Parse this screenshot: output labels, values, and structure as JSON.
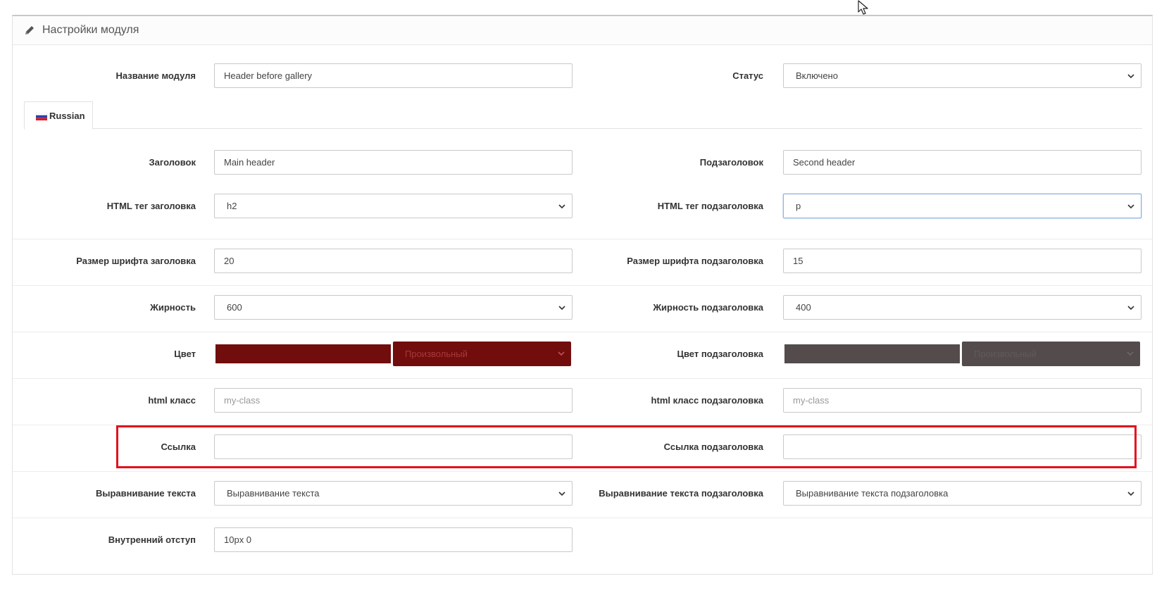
{
  "panel": {
    "title": "Настройки модуля"
  },
  "module_name": {
    "label": "Название модуля",
    "value": "Header before gallery"
  },
  "status": {
    "label": "Статус",
    "value": "Включено"
  },
  "language_tab": {
    "label": "Russian"
  },
  "heading": {
    "label": "Заголовок",
    "value": "Main header"
  },
  "subheading": {
    "label": "Подзаголовок",
    "value": "Second header"
  },
  "heading_tag": {
    "label": "HTML тег заголовка",
    "value": "h2"
  },
  "subheading_tag": {
    "label": "HTML тег подзаголовка",
    "value": "p"
  },
  "heading_font_size": {
    "label": "Размер шрифта заголовка",
    "value": "20"
  },
  "subheading_font_size": {
    "label": "Размер шрифта подзаголовка",
    "value": "15"
  },
  "heading_weight": {
    "label": "Жирность",
    "value": "600"
  },
  "subheading_weight": {
    "label": "Жирность подзаголовка",
    "value": "400"
  },
  "heading_color": {
    "label": "Цвет",
    "mode": "Произвольный",
    "swatch": "#720d0d",
    "select_text_color": "#a33a3a"
  },
  "subheading_color": {
    "label": "Цвет подзаголовка",
    "mode": "Произвольный",
    "swatch": "#534b4c",
    "select_text_color": "#62595a"
  },
  "heading_class": {
    "label": "html класс",
    "placeholder": "my-class"
  },
  "subheading_class": {
    "label": "html класс подзаголовка",
    "placeholder": "my-class"
  },
  "heading_link": {
    "label": "Ссылка",
    "value": ""
  },
  "subheading_link": {
    "label": "Ссылка подзаголовка",
    "value": ""
  },
  "heading_align": {
    "label": "Выравнивание текста",
    "value": "Выравнивание текста"
  },
  "subheading_align": {
    "label": "Выравнивание текста подзаголовка",
    "value": "Выравнивание текста подзаголовка"
  },
  "padding": {
    "label": "Внутренний отступ",
    "value": "10px 0"
  },
  "colors": {
    "highlight": "#e3101c",
    "focus_border": "#8fb3e0"
  }
}
